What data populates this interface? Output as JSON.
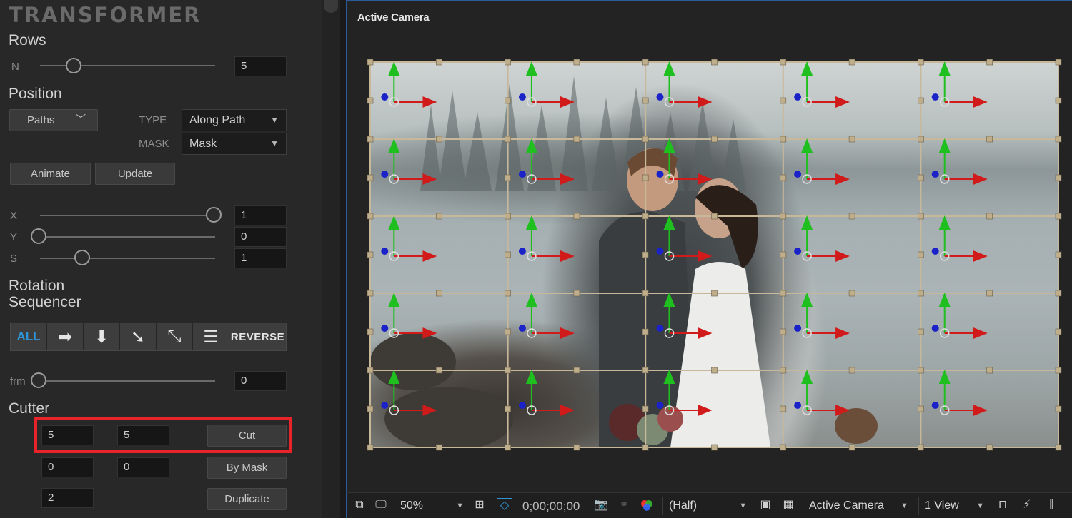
{
  "app": {
    "logo": "TRANSFORMER"
  },
  "rows": {
    "title": "Rows",
    "n_label": "N",
    "n_value": "5",
    "slider_value": 0.2
  },
  "position": {
    "title": "Position",
    "paths_button": "Paths",
    "type_label": "TYPE",
    "type_value": "Along Path",
    "mask_label": "MASK",
    "mask_value": "Mask",
    "animate_button": "Animate",
    "update_button": "Update"
  },
  "xys": [
    {
      "label": "X",
      "value": "1",
      "slider_value": 1.0
    },
    {
      "label": "Y",
      "value": "0",
      "slider_value": 0.0
    },
    {
      "label": "S",
      "value": "1",
      "slider_value": 0.25
    }
  ],
  "rotation": {
    "title_line1": "Rotation",
    "title_line2": "Sequencer",
    "all_label": "ALL",
    "reverse_label": "REVERSE",
    "icons": [
      "arrow-right-icon",
      "arrow-down-icon",
      "arrow-down-right-icon",
      "arrow-diagonal-both-icon",
      "align-lines-icon"
    ]
  },
  "frm": {
    "label": "frm",
    "value": "0",
    "slider_value": 0.0
  },
  "cutter": {
    "title": "Cutter",
    "row1": [
      "5",
      "5"
    ],
    "cut_button": "Cut",
    "row2": [
      "0",
      "0"
    ],
    "by_mask_button": "By Mask",
    "row3": [
      "2"
    ],
    "duplicate_button": "Duplicate",
    "highlight_color": "#e8232a"
  },
  "viewer": {
    "title": "Active Camera",
    "grid": {
      "rows": 5,
      "cols": 5
    },
    "colors": {
      "x_axis": "#d11a1a",
      "y_axis": "#1fbf1f",
      "z_point": "#1a22c8",
      "grid_line": "#c8b89a",
      "handle": "#bfae8c"
    }
  },
  "toolbar": {
    "zoom": "50%",
    "timecode": "0;00;00;00",
    "resolution": "(Half)",
    "camera": "Active Camera",
    "view": "1 View",
    "accent": "#2e95d8"
  }
}
